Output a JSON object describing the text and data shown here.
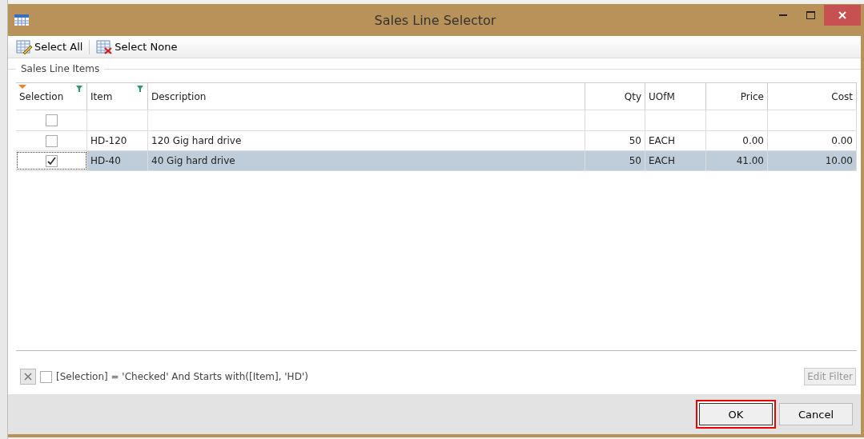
{
  "window": {
    "title": "Sales Line Selector"
  },
  "toolbar": [
    {
      "kind": "select_all",
      "label": "Select All"
    },
    {
      "kind": "select_none",
      "label": "Select None"
    }
  ],
  "group": {
    "title": "Sales Line Items"
  },
  "table": {
    "selection_column": {
      "label": "Selection",
      "filter": true,
      "sorted": true
    },
    "columns": [
      {
        "label": "Item",
        "kind": "text",
        "filter": true,
        "sorted": false
      },
      {
        "label": "Description",
        "kind": "text",
        "filter": false,
        "sorted": false
      },
      {
        "label": "Qty",
        "kind": "number",
        "filter": false,
        "sorted": false
      },
      {
        "label": "UOfM",
        "kind": "text",
        "filter": false,
        "sorted": false
      },
      {
        "label": "Price",
        "kind": "number",
        "filter": false,
        "sorted": false
      },
      {
        "label": "Cost",
        "kind": "number",
        "filter": false,
        "sorted": false
      }
    ],
    "filter_row": {
      "checked": false
    },
    "rows": [
      {
        "checked": false,
        "selected": false,
        "cells": [
          "HD-120",
          "120 Gig hard drive",
          "50",
          "EACH",
          "0.00",
          "0.00"
        ]
      },
      {
        "checked": true,
        "selected": true,
        "cells": [
          "HD-40",
          "40 Gig hard drive",
          "50",
          "EACH",
          "41.00",
          "10.00"
        ]
      }
    ]
  },
  "filter_bar": {
    "enabled": false,
    "expression": "[Selection] = 'Checked' And Starts with([Item], 'HD')",
    "edit_button": {
      "label": "Edit Filter",
      "disabled": true
    }
  },
  "buttons": [
    {
      "label": "OK",
      "focused": true
    },
    {
      "label": "Cancel",
      "focused": false
    }
  ]
}
